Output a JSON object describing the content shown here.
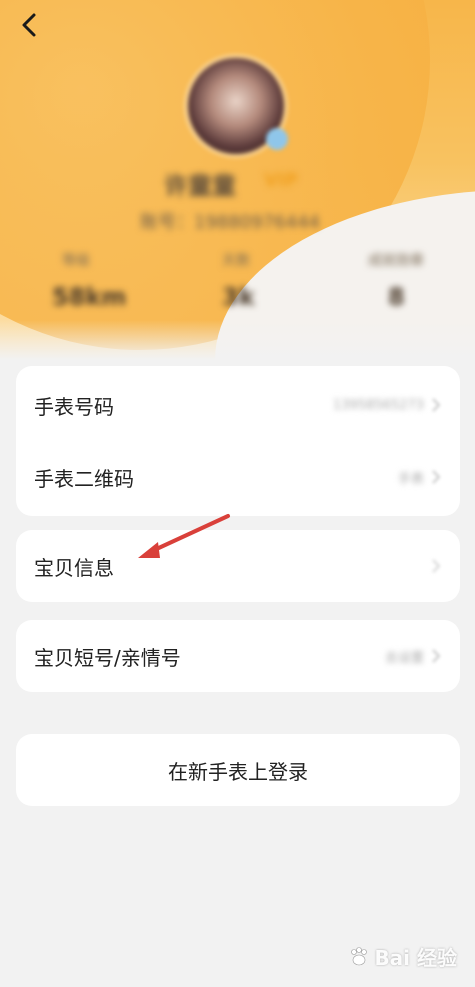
{
  "header": {
    "back_icon": "chevron-left-icon",
    "name": "许童童",
    "vip": "VIP",
    "account": "账号：19880976444",
    "stats": [
      {
        "label": "等级",
        "value": "58km"
      },
      {
        "label": "天数",
        "value": "3k"
      },
      {
        "label": "成就勋章",
        "value": "8"
      }
    ]
  },
  "card1": {
    "rows": [
      {
        "label": "手表号码",
        "value": "13958565273"
      },
      {
        "label": "手表二维码",
        "value": "手表"
      }
    ]
  },
  "card2": {
    "rows": [
      {
        "label": "宝贝信息",
        "value": ""
      }
    ]
  },
  "card3": {
    "rows": [
      {
        "label": "宝贝短号/亲情号",
        "value": "去设置"
      }
    ]
  },
  "login": {
    "label": "在新手表上登录"
  },
  "watermark": {
    "text": "Bai 经验"
  },
  "colors": {
    "header_top": "#f7b64a",
    "header_bottom": "#fde3b3",
    "background": "#f2f2f2",
    "card": "#ffffff",
    "arrow": "#d9403a"
  }
}
